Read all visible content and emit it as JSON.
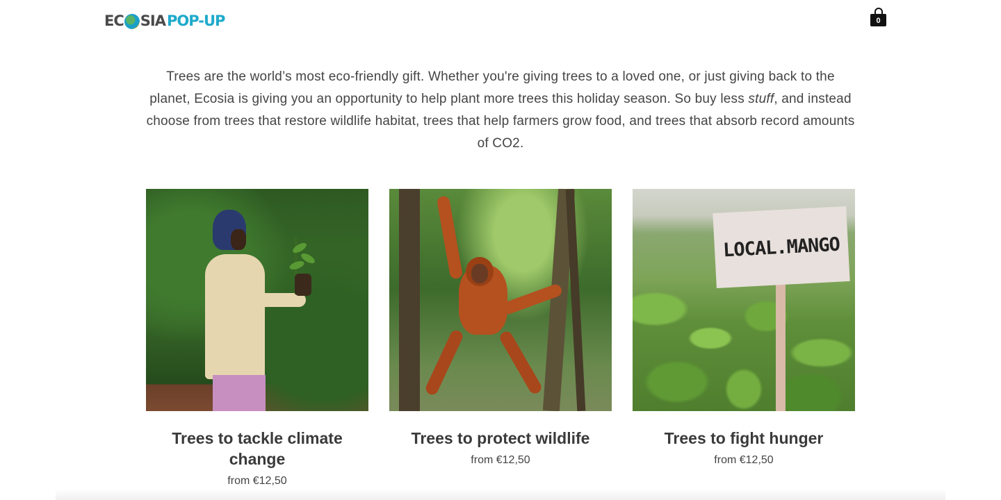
{
  "header": {
    "logo": {
      "part1": "EC",
      "part2": "SIA",
      "part3": "POP-UP"
    },
    "cart": {
      "count": "0",
      "icon": "shopping-bag-icon"
    }
  },
  "intro": {
    "line1": "Trees are the world’s most eco-friendly gift. Whether you're giving trees to a loved one, or just giving back to the planet, Ecosia is giving you an opportunity to help plant more trees this holiday season. So buy less ",
    "emphasis": "stuff",
    "line2": ", and instead choose from trees that restore wildlife habitat, trees that help farmers grow food, and trees that absorb record amounts of CO2."
  },
  "products": [
    {
      "title": "Trees to tackle climate change",
      "price": "from €12,50"
    },
    {
      "title": "Trees to protect wildlife",
      "price": "from €12,50"
    },
    {
      "title": "Trees to fight hunger",
      "price": "from €12,50",
      "sign_text": "LOCAL.MANGO"
    }
  ]
}
